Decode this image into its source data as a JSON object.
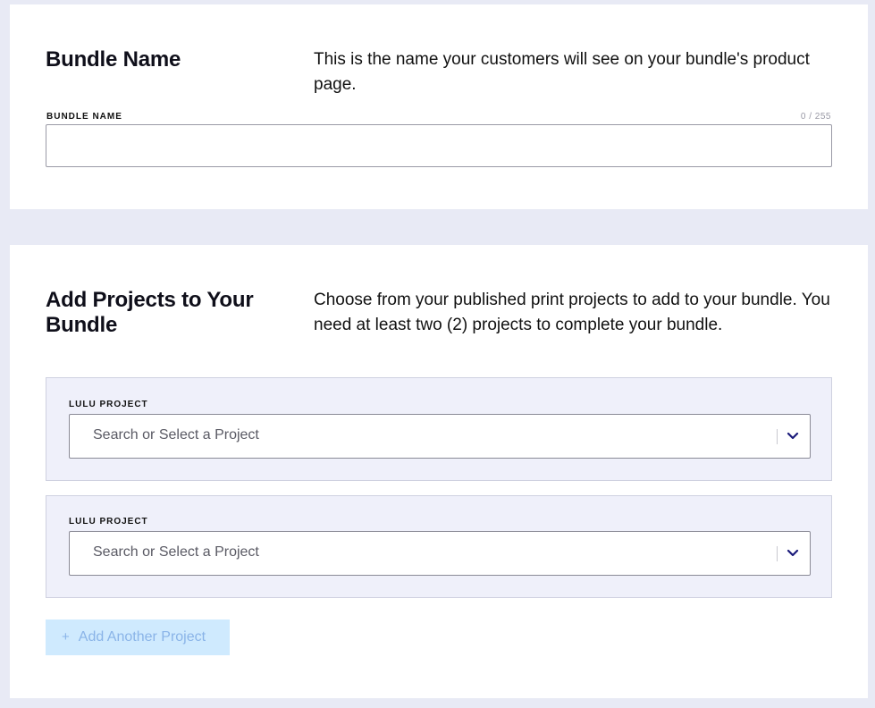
{
  "bundle_name_section": {
    "title": "Bundle Name",
    "description": "This is the name your customers will see on your bundle's product page.",
    "field_label": "BUNDLE NAME",
    "char_count": "0 / 255",
    "value": ""
  },
  "projects_section": {
    "title": "Add Projects to Your Bundle",
    "description": "Choose from your published print projects to add to your bundle. You need at least two (2) projects to complete your bundle.",
    "projects": [
      {
        "label": "LULU PROJECT",
        "placeholder": "Search or Select a Project"
      },
      {
        "label": "LULU PROJECT",
        "placeholder": "Search or Select a Project"
      }
    ],
    "add_button_icon": "+",
    "add_button_label": "Add Another Project"
  },
  "colors": {
    "page_bg": "#e8eaf5",
    "chevron": "#1a1a7a",
    "add_button_bg": "#cfeafe",
    "add_button_text": "#8ab4e8"
  }
}
